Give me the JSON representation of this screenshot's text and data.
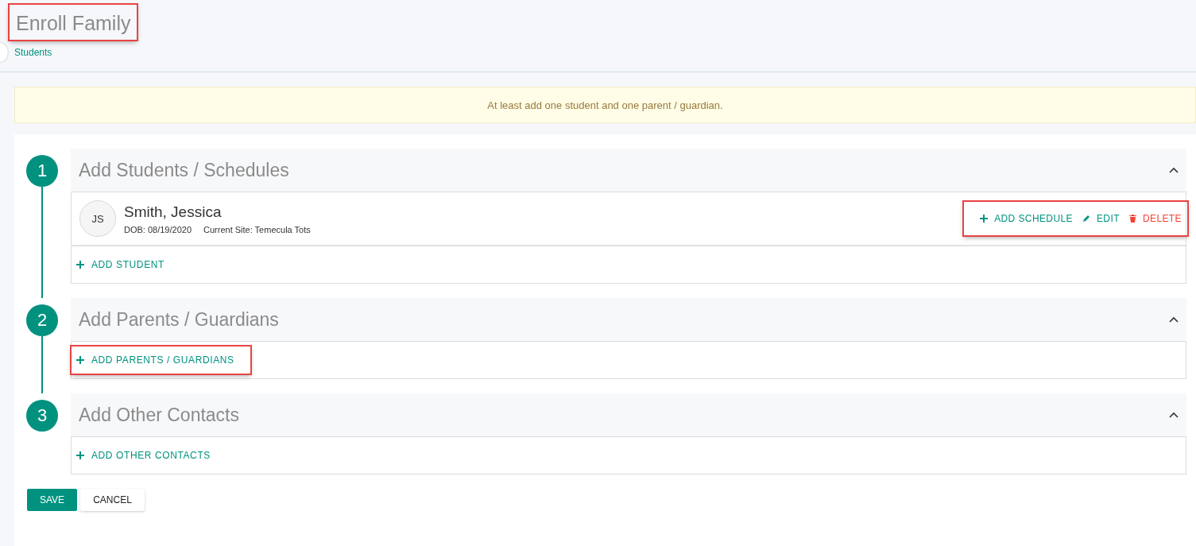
{
  "page": {
    "title": "Enroll Family",
    "title_highlighted": true,
    "breadcrumb": "Students"
  },
  "alert": {
    "text": "At least add one student and one parent / guardian."
  },
  "steps": [
    {
      "number": "1",
      "title": "Add Students / Schedules",
      "expanded": true,
      "records": [
        {
          "initials": "JS",
          "name": "Smith, Jessica",
          "dob": "DOB: 08/19/2020",
          "site": "Current Site: Temecula Tots",
          "actions_highlighted": true,
          "actions": [
            {
              "kind": "add",
              "label": "ADD SCHEDULE"
            },
            {
              "kind": "edit",
              "label": "EDIT"
            },
            {
              "kind": "delete",
              "label": "DELETE"
            }
          ]
        }
      ],
      "add_label": "ADD STUDENT",
      "add_highlighted": false
    },
    {
      "number": "2",
      "title": "Add Parents / Guardians",
      "expanded": true,
      "add_label": "ADD PARENTS / GUARDIANS",
      "add_highlighted": true
    },
    {
      "number": "3",
      "title": "Add Other Contacts",
      "expanded": true,
      "add_label": "ADD OTHER CONTACTS",
      "add_highlighted": false
    }
  ],
  "buttons": [
    {
      "kind": "primary",
      "label": "SAVE"
    },
    {
      "kind": "secondary",
      "label": "CANCEL"
    }
  ]
}
